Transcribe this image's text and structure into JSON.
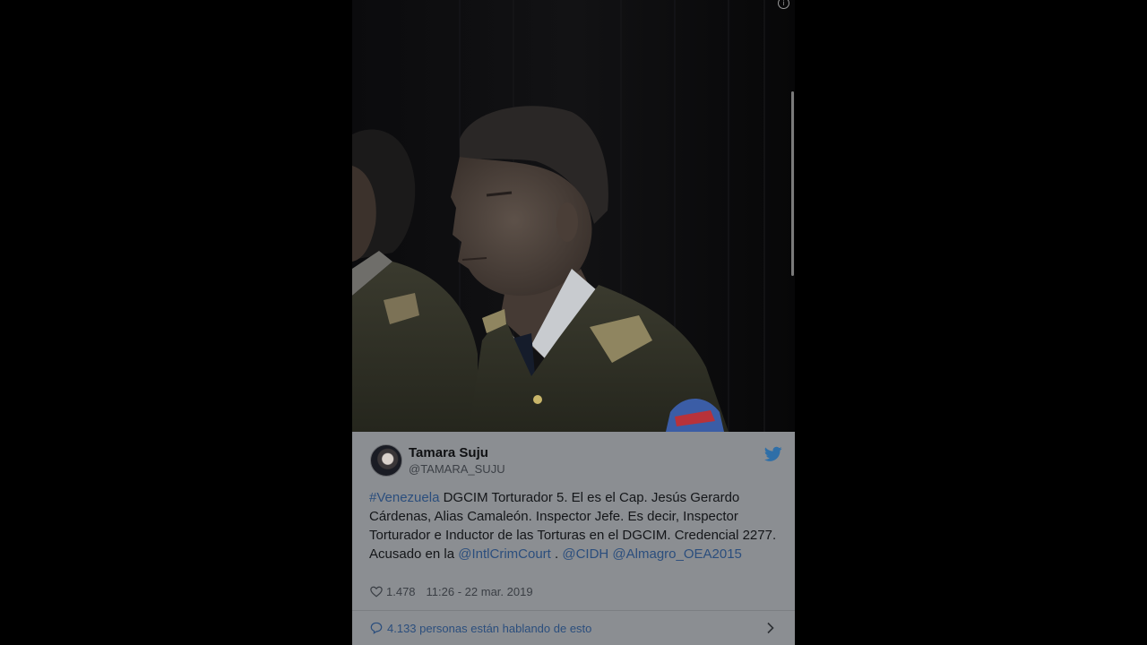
{
  "tweet": {
    "author_name": "Tamara Suju",
    "author_handle": "@TAMARA_SUJU",
    "text_parts": [
      {
        "text": "#Venezuela",
        "link": true
      },
      {
        "text": " DGCIM Torturador 5.  El es el  Cap. Jesús Gerardo Cárdenas, Alias Camaleón.  Inspector Jefe. Es decir, Inspector Torturador e Inductor de las Torturas en el DGCIM. Credencial 2277.  Acusado en la ",
        "link": false
      },
      {
        "text": "@IntlCrimCourt",
        "link": true
      },
      {
        "text": " . ",
        "link": false
      },
      {
        "text": "@CIDH",
        "link": true
      },
      {
        "text": " ",
        "link": false
      },
      {
        "text": "@Almagro_OEA2015",
        "link": true
      }
    ],
    "likes": "1.478",
    "timestamp": "11:26 - 22 mar. 2019",
    "talking": "4.133 personas están hablando de esto"
  },
  "icons": {
    "like": "heart-icon",
    "talking": "speech-bubble-icon",
    "brand": "twitter-bird-icon",
    "more": "chevron-right-icon",
    "info": "info-icon"
  },
  "colors": {
    "background": "#000000",
    "card": "#8b8e92",
    "link": "#2b4e7d",
    "brand": "#2f6fa8"
  }
}
